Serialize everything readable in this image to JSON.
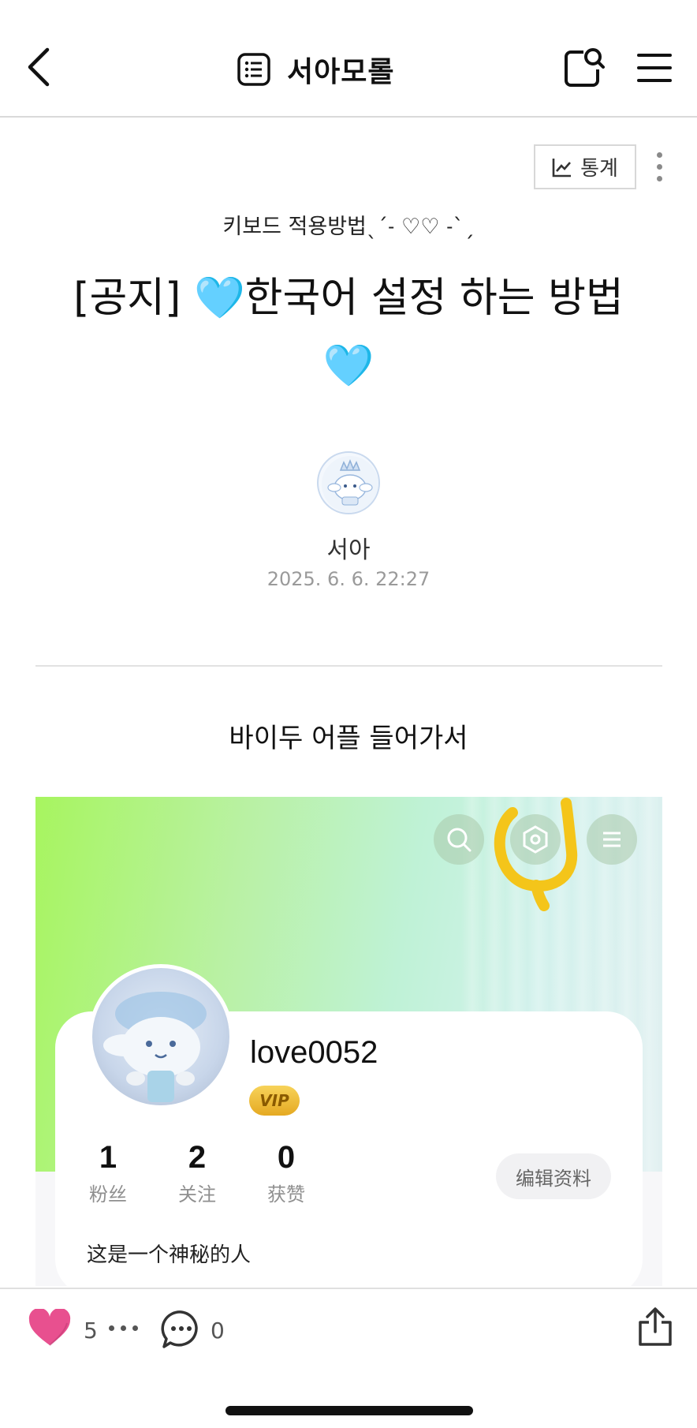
{
  "header": {
    "board_title": "서아모롤"
  },
  "post": {
    "stats_label": "통계",
    "category": "키보드 적용방법ˎˊ˗ ♡♡ ˗ˋˏ",
    "title_text": "[공지] 🩵한국어 설정 하는 방법",
    "title_emoji_trailing": "🩵",
    "author_name": "서아",
    "date": "2025. 6. 6. 22:27",
    "body_text": "바이두 어플 들어가서"
  },
  "embedded_screenshot": {
    "username": "love0052",
    "vip_label": "VIP",
    "stats": [
      {
        "value": "1",
        "label": "粉丝"
      },
      {
        "value": "2",
        "label": "关注"
      },
      {
        "value": "0",
        "label": "获赞"
      }
    ],
    "edit_button": "编辑资料",
    "bio": "这是一个神秘的人",
    "highlight_color": "#F4C51A",
    "icons": [
      "search-icon",
      "settings-hexagon-icon",
      "menu-icon"
    ]
  },
  "footer": {
    "like_count": "5",
    "comment_count": "0"
  },
  "colors": {
    "like_pink": "#E8508F",
    "heart_blue": "#8EDCF2"
  }
}
